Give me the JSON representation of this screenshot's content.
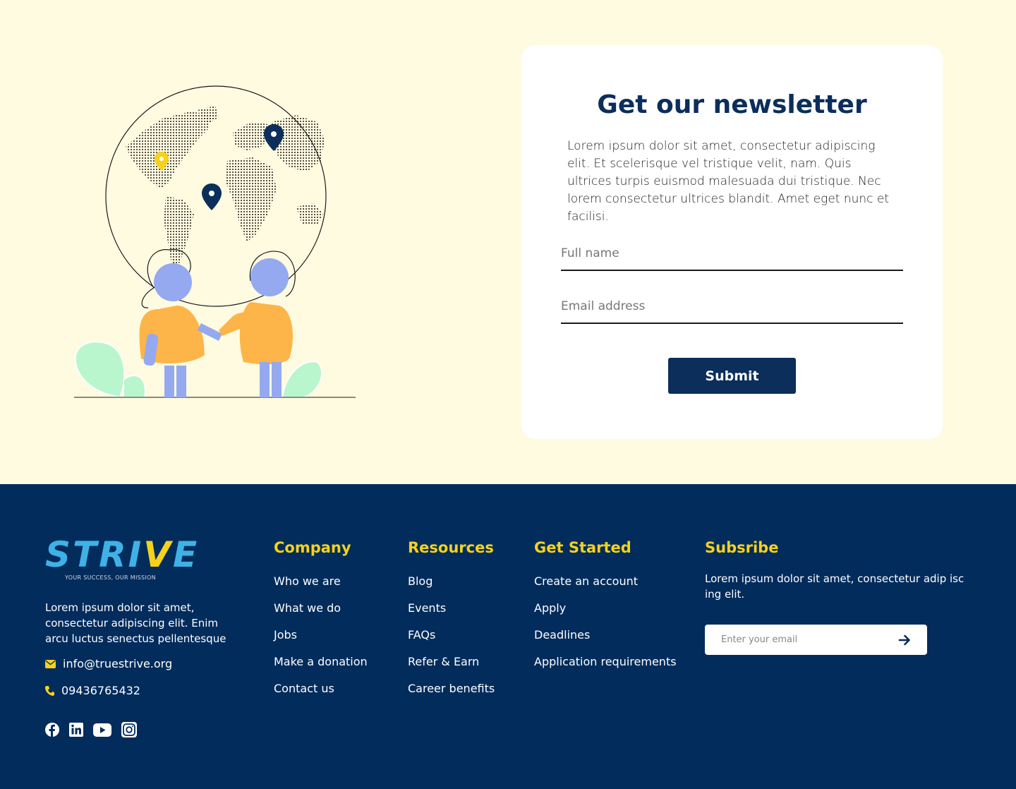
{
  "newsletter": {
    "title": "Get our newsletter",
    "description": "Lorem ipsum dolor sit amet, consectetur adipiscing elit. Et scelerisque vel tristique velit, nam. Quis ultrices turpis euismod malesuada dui tristique. Nec lorem consectetur ultrices blandit. Amet eget nunc et facilisi.",
    "name_placeholder": "Full name",
    "email_placeholder": "Email address",
    "submit_label": "Submit"
  },
  "illustration": {
    "icons": [
      "globe-dotted-map",
      "map-pin-icon",
      "two-people-handshake",
      "leaf-plant"
    ],
    "colors": {
      "pin_dark": "#0b2e5b",
      "pin_yellow": "#f6d21b",
      "skin": "#94a9f0",
      "shirt": "#fdb549",
      "plant": "#b9f6cd"
    }
  },
  "footer": {
    "logo": {
      "word_start": "STRI",
      "word_v": "V",
      "word_end": "E",
      "tagline": "YOUR SUCCESS, OUR MISSION"
    },
    "about": "Lorem ipsum dolor sit amet, consectetur adipiscing elit. Enim arcu luctus senectus pellentesque",
    "email": "info@truestrive.org",
    "phone": "09436765432",
    "social_icons": [
      "facebook-icon",
      "linkedin-icon",
      "youtube-icon",
      "instagram-icon"
    ],
    "columns": {
      "company": {
        "title": "Company",
        "links": [
          "Who we are",
          "What we do",
          "Jobs",
          "Make a donation",
          "Contact us"
        ]
      },
      "resources": {
        "title": "Resources",
        "links": [
          "Blog",
          "Events",
          "FAQs",
          "Refer & Earn",
          "Career benefits"
        ]
      },
      "get_started": {
        "title": "Get Started",
        "links": [
          "Create an account",
          "Apply",
          "Deadlines",
          "Application requirements"
        ]
      }
    },
    "subscribe": {
      "title": "Subsribe",
      "text": "Lorem ipsum dolor sit amet, consectetur adip isc ing elit.",
      "placeholder": "Enter your email"
    },
    "colors": {
      "background": "#022c5c",
      "accent": "#f6d21b",
      "logo_blue": "#3eb2e6"
    }
  }
}
